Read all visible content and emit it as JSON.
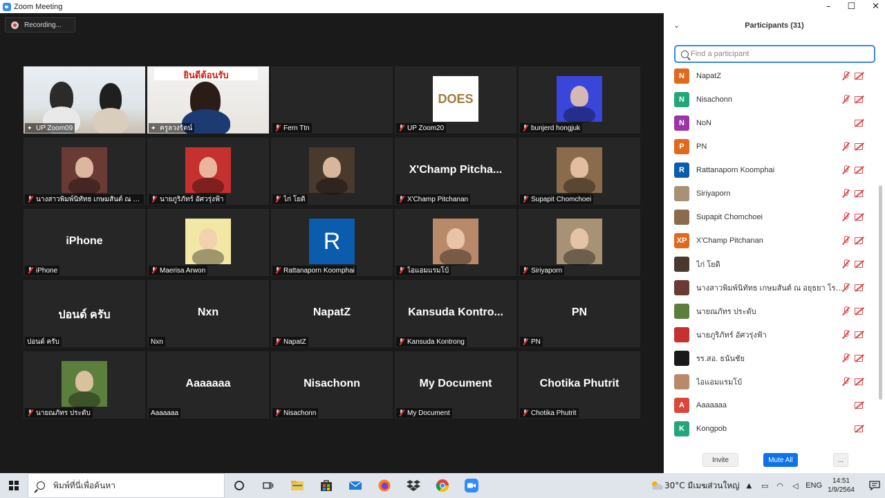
{
  "window": {
    "title": "Zoom Meeting",
    "controls": [
      "–",
      "☐",
      "✕"
    ]
  },
  "recording": {
    "label": "Recording..."
  },
  "tiles": [
    {
      "big": "",
      "caption": "UP Zoom09",
      "icon": "pin",
      "kind": "video-a",
      "active": true
    },
    {
      "big": "",
      "caption": "ครูลวงรัตน์",
      "icon": "pin",
      "kind": "video-b",
      "banner": "ยินดีต้อนรับ"
    },
    {
      "big": "",
      "caption": "Fern Ttn",
      "icon": "mic",
      "kind": "blank"
    },
    {
      "big": "",
      "caption": "UP Zoom20",
      "icon": "mic",
      "kind": "logo",
      "logo": "DOES"
    },
    {
      "big": "",
      "caption": "bunjerd hongjuk",
      "icon": "mic",
      "kind": "photo",
      "color": "#3a45d9"
    },
    {
      "big": "",
      "caption": "นางสาวพิมพ์นิทัทธ เกษมสันต์ ณ อยุธ...",
      "icon": "mic",
      "kind": "photo",
      "color": "#6a3b35"
    },
    {
      "big": "",
      "caption": "นายภูริภัทร์ อัศวรุ่งฟ้า",
      "icon": "mic",
      "kind": "photo",
      "color": "#c4312e"
    },
    {
      "big": "",
      "caption": "ไก่ โยดิ",
      "icon": "mic",
      "kind": "photo",
      "color": "#4a3a2e"
    },
    {
      "big": "X'Champ  Pitcha...",
      "caption": "X'Champ Pitchanan",
      "icon": "mic",
      "kind": "name"
    },
    {
      "big": "",
      "caption": "Supapit Chomchoei",
      "icon": "mic",
      "kind": "photo",
      "color": "#8a6c4c"
    },
    {
      "big": "iPhone",
      "caption": "iPhone",
      "icon": "mic",
      "kind": "name"
    },
    {
      "big": "",
      "caption": "Maerisa Arwon",
      "icon": "mic",
      "kind": "photo",
      "color": "#f3e7a6"
    },
    {
      "big": "",
      "caption": "Rattanaporn Koomphai",
      "icon": "mic",
      "kind": "letter",
      "letter": "R",
      "color": "#0b5cad"
    },
    {
      "big": "",
      "caption": "ไอแอมแรมโบ้",
      "icon": "mic",
      "kind": "photo",
      "color": "#b98a6a"
    },
    {
      "big": "",
      "caption": "Siriyaporn",
      "icon": "mic",
      "kind": "photo",
      "color": "#a79276"
    },
    {
      "big": "ปอนด์ ครับ",
      "caption": "ปอนด์ ครับ",
      "icon": "none",
      "kind": "name"
    },
    {
      "big": "Nxn",
      "caption": "Nxn",
      "icon": "none",
      "kind": "name"
    },
    {
      "big": "NapatZ",
      "caption": "NapatZ",
      "icon": "mic",
      "kind": "name"
    },
    {
      "big": "Kansuda  Kontro...",
      "caption": "Kansuda Kontrong",
      "icon": "mic",
      "kind": "name"
    },
    {
      "big": "PN",
      "caption": "PN",
      "icon": "mic",
      "kind": "name"
    },
    {
      "big": "",
      "caption": "นายณภัทร ประดับ",
      "icon": "mic",
      "kind": "photo",
      "color": "#5d7f3e"
    },
    {
      "big": "Aaaaaaa",
      "caption": "Aaaaaaa",
      "icon": "none",
      "kind": "name"
    },
    {
      "big": "Nisachonn",
      "caption": "Nisachonn",
      "icon": "mic",
      "kind": "name"
    },
    {
      "big": "My Document",
      "caption": "My Document",
      "icon": "mic",
      "kind": "name"
    },
    {
      "big": "Chotika Phutrit",
      "caption": "Chotika Phutrit",
      "icon": "mic",
      "kind": "name"
    }
  ],
  "participants_panel": {
    "title": "Participants (31)",
    "search_placeholder": "Find a participant",
    "items": [
      {
        "avatar": "N",
        "color": "#e0691e",
        "name": "NapatZ",
        "mic_muted": true,
        "video_off": true
      },
      {
        "avatar": "N",
        "color": "#23a67a",
        "name": "Nisachonn",
        "mic_muted": true,
        "video_off": true
      },
      {
        "avatar": "N",
        "color": "#9b35a7",
        "name": "NoN",
        "mic_muted": false,
        "video_off": true
      },
      {
        "avatar": "P",
        "color": "#e0691e",
        "name": "PN",
        "mic_muted": true,
        "video_off": true
      },
      {
        "avatar": "R",
        "color": "#0b5cad",
        "name": "Rattanaporn Koomphai",
        "mic_muted": true,
        "video_off": true
      },
      {
        "avatar": "",
        "color": "#a79276",
        "name": "Siriyaporn",
        "mic_muted": true,
        "video_off": true
      },
      {
        "avatar": "",
        "color": "#8a6c4c",
        "name": "Supapit Chomchoei",
        "mic_muted": true,
        "video_off": true
      },
      {
        "avatar": "XP",
        "color": "#e0691e",
        "name": "X'Champ Pitchanan",
        "mic_muted": true,
        "video_off": true
      },
      {
        "avatar": "",
        "color": "#4a3a2e",
        "name": "ไก่ โยดิ",
        "mic_muted": true,
        "video_off": true
      },
      {
        "avatar": "",
        "color": "#6a3b35",
        "name": "นางสาวพิมพ์นิทัทธ เกษมสันต์ ณ อยุธยา โรงเรียนสวร...",
        "mic_muted": true,
        "video_off": true
      },
      {
        "avatar": "",
        "color": "#5d7f3e",
        "name": "นายณภัทร ประดับ",
        "mic_muted": true,
        "video_off": true
      },
      {
        "avatar": "",
        "color": "#c4312e",
        "name": "นายภูริภัทร์ อัศวรุ่งฟ้า",
        "mic_muted": true,
        "video_off": true
      },
      {
        "avatar": "",
        "color": "#1a1a1a",
        "name": "รร.สอ. ธนันชัย",
        "mic_muted": true,
        "video_off": true
      },
      {
        "avatar": "",
        "color": "#b98a6a",
        "name": "ไอแอมแรมโบ้",
        "mic_muted": true,
        "video_off": true
      },
      {
        "avatar": "A",
        "color": "#d9483b",
        "name": "Aaaaaaa",
        "mic_muted": false,
        "video_off": true
      },
      {
        "avatar": "K",
        "color": "#23a67a",
        "name": "Kongpob",
        "mic_muted": false,
        "video_off": true
      }
    ],
    "buttons": {
      "invite": "Invite",
      "mute_all": "Mute All",
      "more": "..."
    }
  },
  "taskbar": {
    "search_text": "พิมพ์ที่นี่เพื่อค้นหา",
    "weather": "30°C  มีเมฆส่วนใหญ่",
    "language": "ENG",
    "time": "14:51",
    "date": "1/9/2564"
  }
}
